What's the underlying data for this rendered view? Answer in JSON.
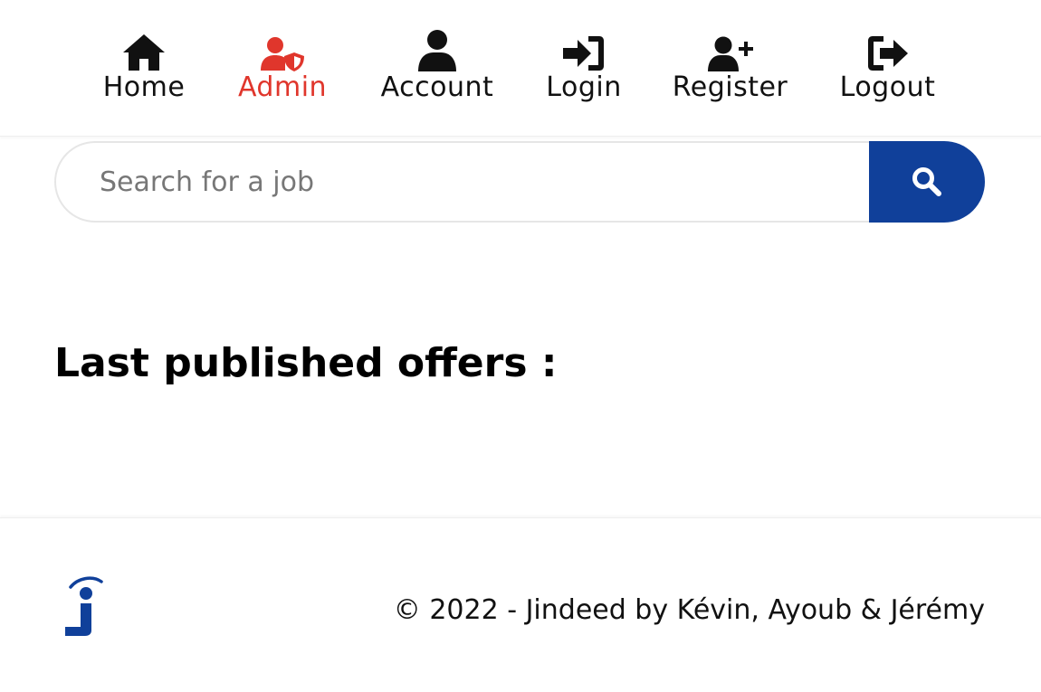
{
  "colors": {
    "accent": "#e0362c",
    "brand_blue": "#10409a",
    "text": "#111111"
  },
  "nav": {
    "items": [
      {
        "label": "Home",
        "icon": "home-icon"
      },
      {
        "label": "Admin",
        "icon": "admin-user-shield-icon",
        "active": true
      },
      {
        "label": "Account",
        "icon": "user-icon"
      },
      {
        "label": "Login",
        "icon": "sign-in-icon"
      },
      {
        "label": "Register",
        "icon": "user-plus-icon"
      },
      {
        "label": "Logout",
        "icon": "sign-out-icon"
      }
    ]
  },
  "search": {
    "placeholder": "Search for a job",
    "value": "",
    "button_icon": "search-icon"
  },
  "main": {
    "section_title": "Last published offers :"
  },
  "footer": {
    "logo_icon": "jindeed-logo",
    "copyright": "© 2022 - Jindeed by Kévin, Ayoub & Jérémy"
  }
}
